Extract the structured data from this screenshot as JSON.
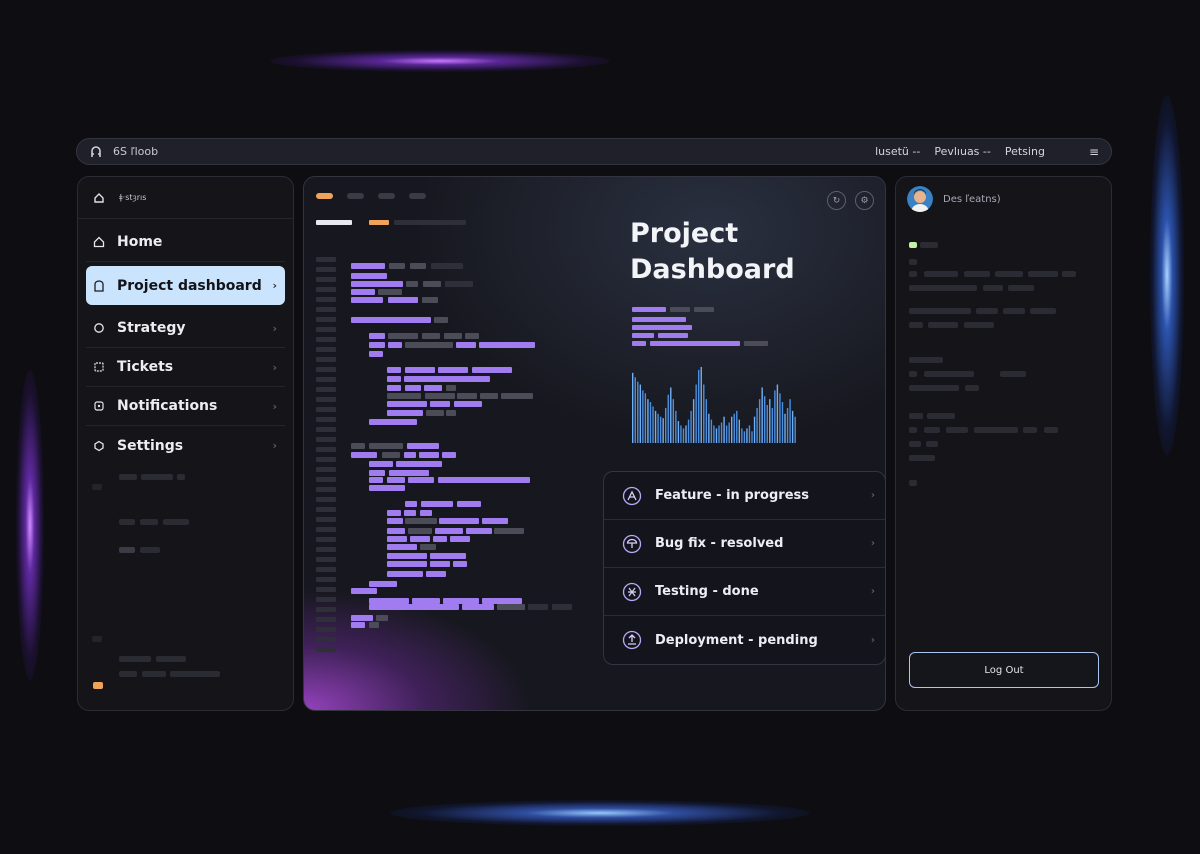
{
  "topbar": {
    "app_title": "6S ľloob",
    "links": [
      "lusetü --",
      "Pevlıuas --",
      "Petsing"
    ],
    "menu_icon": "hamburger-icon"
  },
  "sidebar": {
    "brand_text": "ǂ·stȝrıs",
    "items": [
      {
        "label": "Home",
        "icon": "home-icon",
        "active": false
      },
      {
        "label": "Project dashboard",
        "icon": "dashboard-icon",
        "active": true
      },
      {
        "label": "Strategy",
        "icon": "chat-icon",
        "active": false
      },
      {
        "label": "Tickets",
        "icon": "ticket-icon",
        "active": false
      },
      {
        "label": "Notifications",
        "icon": "bell-icon",
        "active": false
      },
      {
        "label": "Settings",
        "icon": "gear-icon",
        "active": false
      }
    ]
  },
  "main": {
    "title_line1": "Project",
    "title_line2": "Dashboard",
    "controls": [
      "refresh-icon",
      "settings-icon"
    ],
    "tasks": [
      {
        "label": "Feature - in progress",
        "icon": "progress-icon"
      },
      {
        "label": "Bug fix - resolved",
        "icon": "bug-icon"
      },
      {
        "label": "Testing - done",
        "icon": "testing-icon"
      },
      {
        "label": "Deployment - pending",
        "icon": "deploy-icon"
      }
    ]
  },
  "user_panel": {
    "user_name": "Des ľeatns)",
    "logout_label": "Log Out"
  },
  "colors": {
    "accent_purple": "#a07cf0",
    "accent_orange": "#f2a35a",
    "active_nav": "#cbe4fd",
    "chart_blue": "#4b8fe0",
    "glow_purple": "#b264ff",
    "glow_blue": "#3a78ff"
  },
  "chart_data": {
    "type": "bar",
    "values": [
      48,
      45,
      42,
      40,
      36,
      34,
      30,
      28,
      25,
      22,
      20,
      18,
      17,
      24,
      33,
      38,
      30,
      22,
      15,
      12,
      10,
      12,
      16,
      22,
      30,
      40,
      50,
      52,
      40,
      30,
      20,
      16,
      12,
      10,
      12,
      14,
      18,
      12,
      14,
      18,
      20,
      22,
      16,
      10,
      8,
      10,
      12,
      8,
      18,
      24,
      30,
      38,
      32,
      26,
      30,
      24,
      36,
      40,
      34,
      28,
      20,
      24,
      30,
      22,
      18
    ],
    "series": [
      {
        "values": "see values"
      }
    ]
  }
}
